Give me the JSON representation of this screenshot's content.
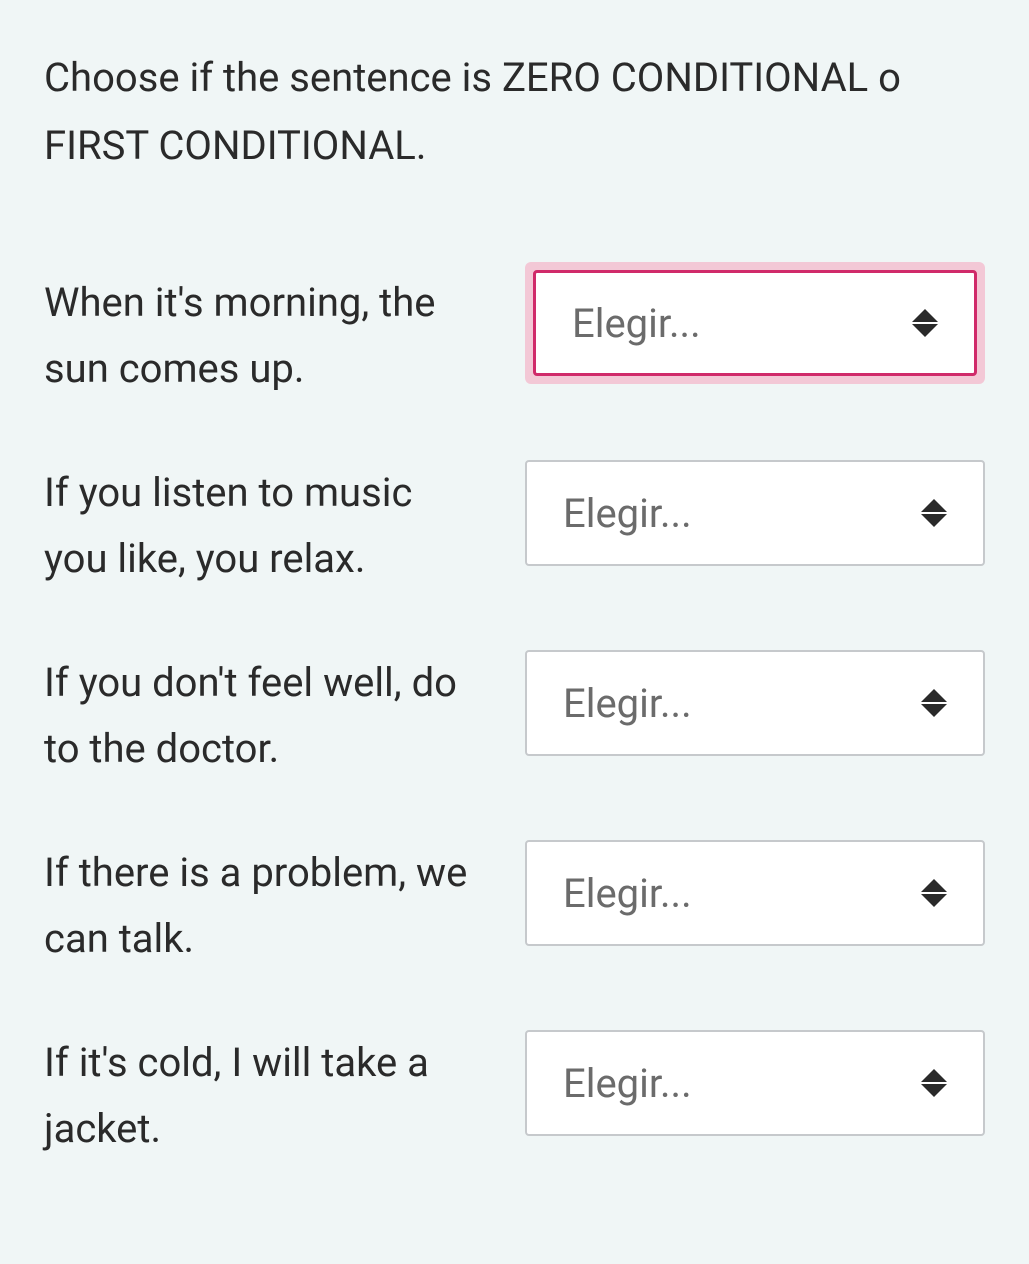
{
  "instructions": "Choose if the sentence is ZERO CONDITIONAL o FIRST CONDITIONAL.",
  "select_placeholder": "Elegir...",
  "questions": [
    {
      "prompt": "When it's morning, the sun comes up.",
      "highlighted": true
    },
    {
      "prompt": "If you listen to music you like, you relax.",
      "highlighted": false
    },
    {
      "prompt": "If you don't feel well, do to the doctor.",
      "highlighted": false
    },
    {
      "prompt": "If there is a problem, we can talk.",
      "highlighted": false
    },
    {
      "prompt": "If it's cold, I will take a jacket.",
      "highlighted": false
    }
  ]
}
